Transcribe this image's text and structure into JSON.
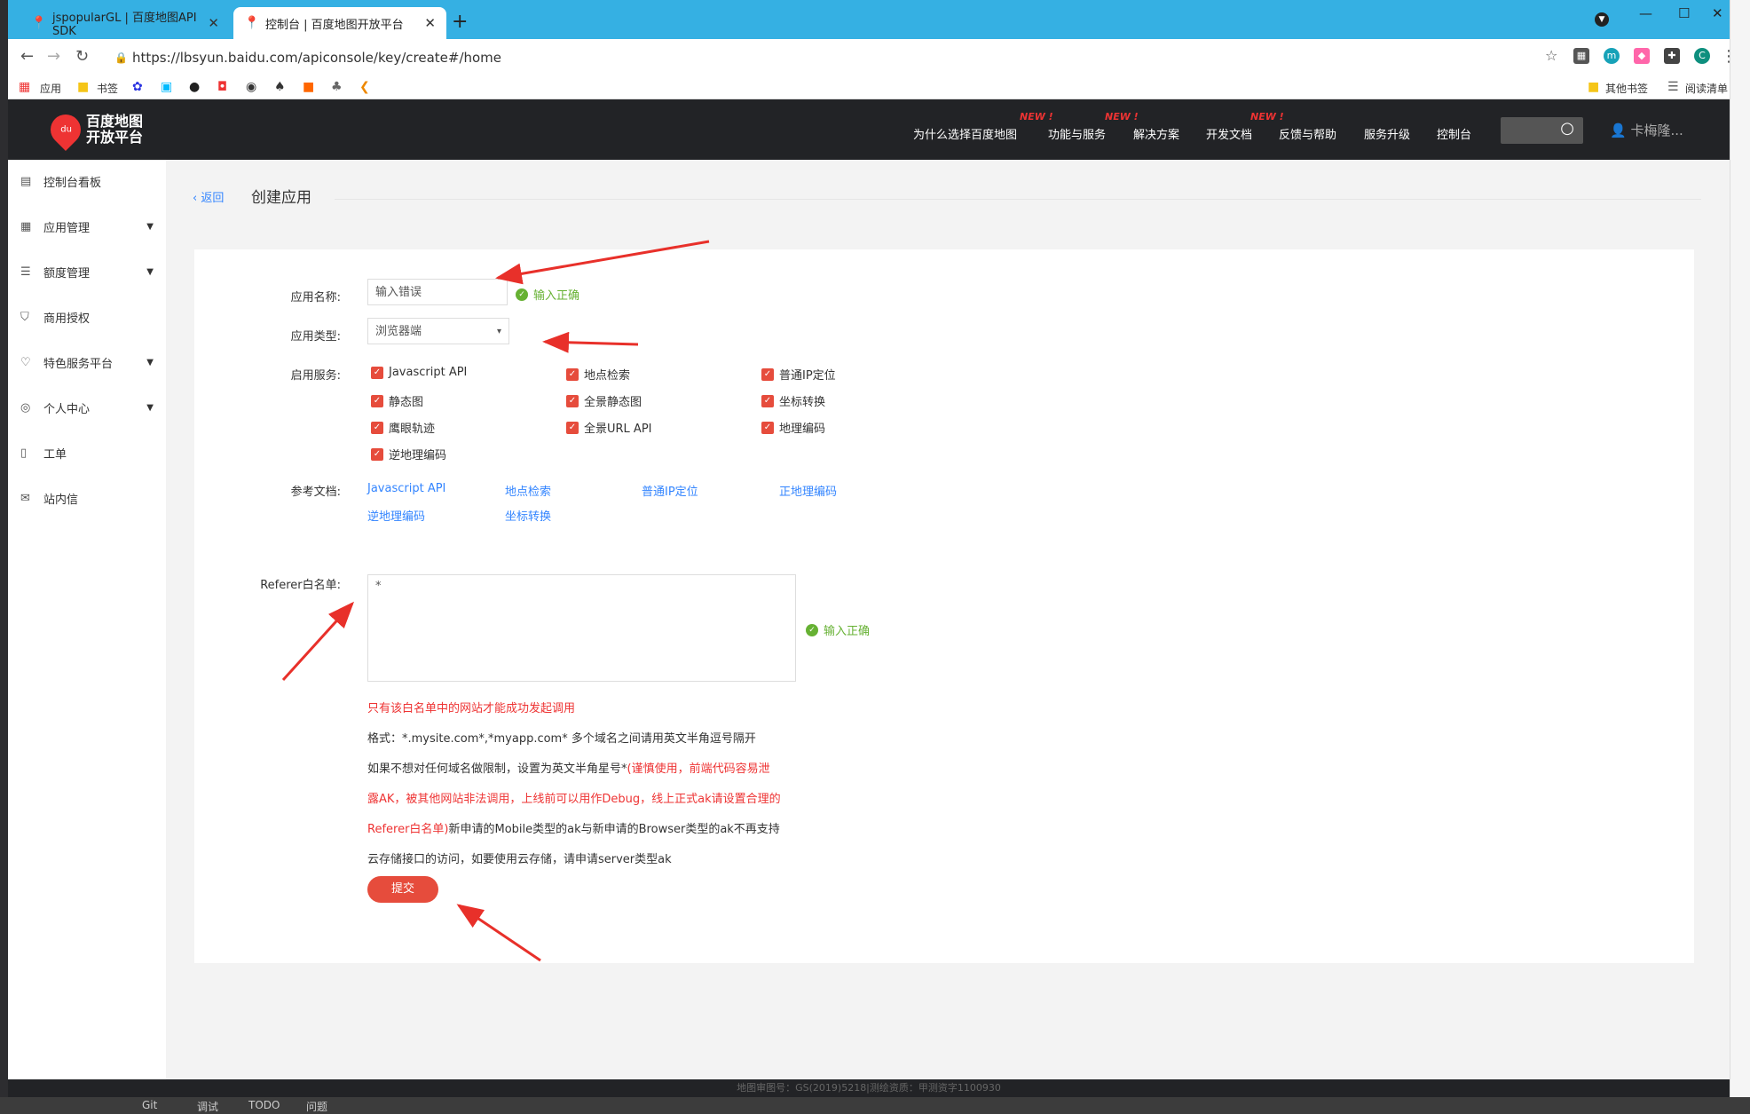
{
  "browser": {
    "tabs": [
      {
        "title": "jspopularGL | 百度地图API SDK",
        "active": false
      },
      {
        "title": "控制台 | 百度地图开放平台",
        "active": true
      }
    ],
    "url": "https://lbsyun.baidu.com/apiconsole/key/create#/home",
    "ext_m": "m",
    "profile": "C",
    "bookmarks": [
      "应用",
      "书签"
    ],
    "other_bookmarks": "其他书签",
    "reading_list": "阅读清单"
  },
  "header": {
    "logo_line1": "百度地图",
    "logo_line2": "开放平台",
    "logo_pin": "du",
    "nav": [
      {
        "label": "为什么选择百度地图",
        "new": "NEW !"
      },
      {
        "label": "功能与服务",
        "new": "NEW !"
      },
      {
        "label": "解决方案",
        "new": ""
      },
      {
        "label": "开发文档",
        "new": "NEW !"
      },
      {
        "label": "反馈与帮助",
        "new": ""
      },
      {
        "label": "服务升级",
        "new": ""
      },
      {
        "label": "控制台",
        "new": ""
      }
    ],
    "user": "卡梅隆..."
  },
  "sidebar": {
    "items": [
      {
        "label": "控制台看板",
        "icon": "dashboard-icon",
        "expandable": false
      },
      {
        "label": "应用管理",
        "icon": "grid-icon",
        "expandable": true
      },
      {
        "label": "额度管理",
        "icon": "sliders-icon",
        "expandable": true
      },
      {
        "label": "商用授权",
        "icon": "shield-icon",
        "expandable": false
      },
      {
        "label": "特色服务平台",
        "icon": "heart-icon",
        "expandable": true
      },
      {
        "label": "个人中心",
        "icon": "user-icon",
        "expandable": true
      },
      {
        "label": "工单",
        "icon": "clipboard-icon",
        "expandable": false
      },
      {
        "label": "站内信",
        "icon": "mail-icon",
        "expandable": false
      }
    ]
  },
  "main": {
    "back_label": "返回",
    "title": "创建应用",
    "form": {
      "app_name_label": "应用名称:",
      "app_name_value": "输入错误",
      "app_name_ok": "输入正确",
      "app_type_label": "应用类型:",
      "app_type_value": "浏览器端",
      "services_label": "启用服务:",
      "services": [
        "Javascript API",
        "地点检索",
        "普通IP定位",
        "静态图",
        "全景静态图",
        "坐标转换",
        "鹰眼轨迹",
        "全景URL API",
        "地理编码",
        "逆地理编码"
      ],
      "docs_label": "参考文档:",
      "docs": [
        "Javascript API",
        "地点检索",
        "普通IP定位",
        "正地理编码",
        "逆地理编码",
        "坐标转换"
      ],
      "referer_label": "Referer白名单:",
      "referer_value": "*",
      "referer_ok": "输入正确",
      "notes": {
        "n1": "只有该白名单中的网站才能成功发起调用",
        "n2": "格式：*.mysite.com*,*myapp.com* 多个域名之间请用英文半角逗号隔开",
        "n3a": "如果不想对任何域名做限制，设置为英文半角星号*",
        "n3b": "(谨慎使用，前端代码容易泄",
        "n4": "露AK，被其他网站非法调用，上线前可以用作Debug，线上正式ak请设置合理的",
        "n5a": "Referer白名单)",
        "n5b": "新申请的Mobile类型的ak与新申请的Browser类型的ak不再支持",
        "n6": "云存储接口的访问，如要使用云存储，请申请server类型ak"
      },
      "submit_label": "提交"
    }
  },
  "footer": "地图审图号：GS(2019)5218|测绘资质：甲测资字1100930",
  "taskbar": [
    "Git",
    "调试",
    "TODO",
    "问题"
  ],
  "colors": {
    "accent": "#e64c3c",
    "link": "#3385ff",
    "success": "#66b133",
    "nav_bg": "#222326",
    "tabbar": "#35b0e3"
  }
}
